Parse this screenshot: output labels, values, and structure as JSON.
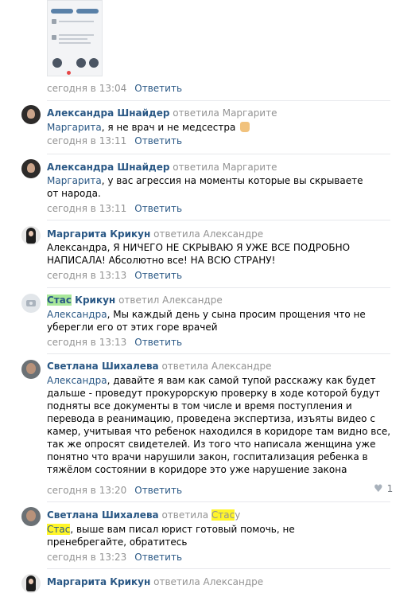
{
  "first": {
    "time": "сегодня в 13:04",
    "reply": "Ответить"
  },
  "comments": [
    {
      "author": "Александра Шнайдер",
      "replied": "ответила Маргарите",
      "addr": "Маргарита",
      "text": ", я не врач и не медсестра",
      "emoji": "raised-hand-icon",
      "time": "сегодня в 13:11",
      "reply": "Ответить"
    },
    {
      "author": "Александра Шнайдер",
      "replied": "ответила Маргарите",
      "addr": "Маргарита",
      "text": ", у вас агрессия на моменты которые вы скрываете от народа.",
      "time": "сегодня в 13:11",
      "reply": "Ответить"
    },
    {
      "author": "Маргарита Крикун",
      "replied": "ответила Александре",
      "text": "Александра, Я НИЧЕГО НЕ СКРЫВАЮ Я УЖЕ ВСЕ ПОДРОБНО НАПИСАЛА! Абсолютно все! НА ВСЮ СТРАНУ!",
      "time": "сегодня в 13:13",
      "reply": "Ответить"
    },
    {
      "author_first": "Стас",
      "author_rest": " Крикун",
      "replied": "ответил Александре",
      "addr": "Александра",
      "text": ", Мы каждый день у сына просим прощения что не уберегли его от этих горе врачей",
      "time": "сегодня в 13:13",
      "reply": "Ответить"
    },
    {
      "author": "Светлана Шихалева",
      "replied": "ответила Александре",
      "addr": "Александра",
      "text": ", давайте я вам как самой тупой расскажу как будет дальше - проведут прокурорскую проверку в ходе которой будут подняты все документы в том числе и время поступления и перевода в реанимацию, проведена экспертиза, изъяты видео с камер, учитывая что ребенок находился в коридоре там видно все, так же опросят свидетелей. Из того что написала женщина уже понятно что врачи нарушили закон, госпитализация ребенка в тяжёлом состоянии в коридоре это уже нарушение закона",
      "time": "сегодня в 13:20",
      "reply": "Ответить",
      "likes": "1"
    },
    {
      "author": "Светлана Шихалева",
      "replied_pre": "ответила ",
      "replied_hl": "Стас",
      "replied_post": "у",
      "addr": "Стас",
      "text": ", выше вам писал юрист готовый помочь, не пренебрегайте, обратитесь",
      "time": "сегодня в 13:23",
      "reply": "Ответить"
    },
    {
      "author": "Маргарита Крикун",
      "replied": "ответила Александре"
    }
  ]
}
